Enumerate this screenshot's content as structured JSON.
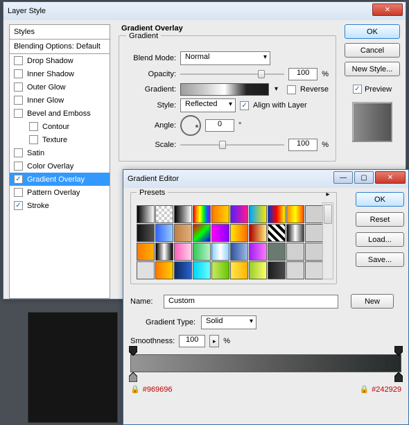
{
  "layerStyle": {
    "title": "Layer Style",
    "stylesHeader": "Styles",
    "blendingDefault": "Blending Options: Default",
    "items": [
      {
        "label": "Drop Shadow",
        "checked": false
      },
      {
        "label": "Inner Shadow",
        "checked": false
      },
      {
        "label": "Outer Glow",
        "checked": false
      },
      {
        "label": "Inner Glow",
        "checked": false
      },
      {
        "label": "Bevel and Emboss",
        "checked": false
      },
      {
        "label": "Contour",
        "checked": false,
        "indent": true
      },
      {
        "label": "Texture",
        "checked": false,
        "indent": true
      },
      {
        "label": "Satin",
        "checked": false
      },
      {
        "label": "Color Overlay",
        "checked": false
      },
      {
        "label": "Gradient Overlay",
        "checked": true,
        "selected": true
      },
      {
        "label": "Pattern Overlay",
        "checked": false
      },
      {
        "label": "Stroke",
        "checked": true
      }
    ],
    "buttons": {
      "ok": "OK",
      "cancel": "Cancel",
      "newStyle": "New Style...",
      "preview": "Preview"
    },
    "overlay": {
      "sectionTitle": "Gradient Overlay",
      "groupTitle": "Gradient",
      "blendModeLabel": "Blend Mode:",
      "blendMode": "Normal",
      "opacityLabel": "Opacity:",
      "opacity": "100",
      "percent": "%",
      "gradientLabel": "Gradient:",
      "reverseLabel": "Reverse",
      "styleLabel": "Style:",
      "style": "Reflected",
      "alignLabel": "Align with Layer",
      "angleLabel": "Angle:",
      "angle": "0",
      "deg": "°",
      "scaleLabel": "Scale:",
      "scale": "100"
    }
  },
  "gradientEditor": {
    "title": "Gradient Editor",
    "presetsLabel": "Presets",
    "buttons": {
      "ok": "OK",
      "reset": "Reset",
      "load": "Load...",
      "save": "Save...",
      "new": "New"
    },
    "nameLabel": "Name:",
    "name": "Custom",
    "typeLabel": "Gradient Type:",
    "type": "Solid",
    "smoothLabel": "Smoothness:",
    "smooth": "100",
    "percent": "%",
    "colorLeft": "#969696",
    "colorRight": "#242929",
    "presets": [
      "linear-gradient(to right,#000,#fff)",
      "repeating-conic-gradient(#ccc 0 25%,#fff 0 50%) 0 0/8px 8px",
      "linear-gradient(to right,#000,#fff)",
      "linear-gradient(to right,#ff0000,#ff9900,#ffff00,#00ff00,#0066ff,#9900ff)",
      "linear-gradient(to right,#ff7a00,#ffd400)",
      "linear-gradient(to right,#5a1aff,#ff1a8c)",
      "linear-gradient(to right,#00a2ff,#ffe600)",
      "linear-gradient(to right,#0033cc,#ff0000,#ffff00)",
      "linear-gradient(to right,#ff8a00,#ffff00,#ff4d00)",
      "#cfcfcf",
      "linear-gradient(to right,#121212,#525252)",
      "linear-gradient(to right,#3366ff,#99ccff)",
      "linear-gradient(to right,#c08040,#e0b080)",
      "linear-gradient(135deg,#ff0000,#00ff00,#0000ff)",
      "linear-gradient(to right,#ff00ff,#8800ff)",
      "linear-gradient(to right,#ffe600,#ff6a00)",
      "linear-gradient(to right,#ac0000,#ffef7a)",
      "repeating-linear-gradient(45deg,#000 0 4px,#fff 4px 8px)",
      "linear-gradient(to right,#0a0a0a,#fff,#3f3f3f)",
      "#d0d0d0",
      "linear-gradient(to right,#ff7a00,#ffb000)",
      "linear-gradient(to right,#000,#fff,#000)",
      "linear-gradient(to right,#ff5ebc,#ffd1ea)",
      "linear-gradient(to right,#34c759,#b7f2c8)",
      "linear-gradient(to right,#8ed1ff,#fff,#8ed1ff)",
      "linear-gradient(to right,#2e53a0,#9fb9e6)",
      "linear-gradient(to right,#a020f0,#ff77ff)",
      "#6b7a70",
      "#d0d0d0",
      "#d0d0d0",
      "#e0e0e0",
      "linear-gradient(to right,#ff7a00,#ffcc00)",
      "linear-gradient(to right,#0b2a66,#2a62c9)",
      "linear-gradient(to right,#00d4ff,#66ffff)",
      "linear-gradient(to right,#c8e866,#66c800)",
      "linear-gradient(to right,#ffe84d,#ffb300)",
      "linear-gradient(to right,#9acd32,#ffff66)",
      "linear-gradient(to right,#1d1d1d,#4a4a4a)",
      "#d8d8d8",
      "#d8d8d8"
    ]
  }
}
